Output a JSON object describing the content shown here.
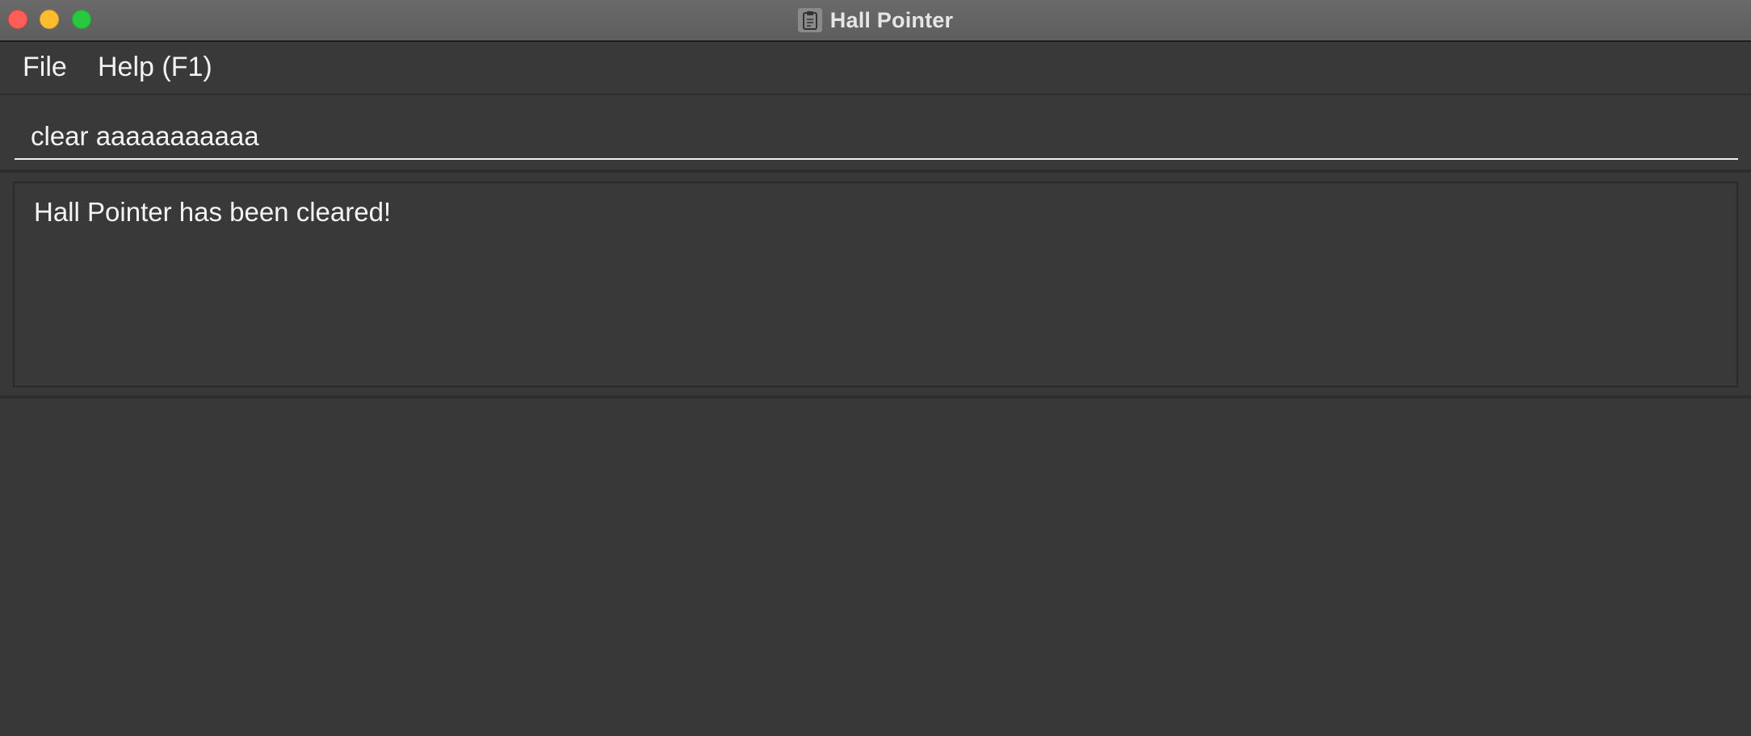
{
  "window": {
    "title": "Hall Pointer",
    "app_icon": "clipboard-icon"
  },
  "menu": {
    "items": [
      {
        "label": "File"
      },
      {
        "label": "Help (F1)"
      }
    ]
  },
  "command": {
    "value": "clear aaaaaaaaaaa"
  },
  "result": {
    "message": "Hall Pointer has been cleared!"
  },
  "colors": {
    "close": "#ff5f57",
    "minimize": "#febc2e",
    "maximize": "#28c840",
    "background": "#383838"
  }
}
